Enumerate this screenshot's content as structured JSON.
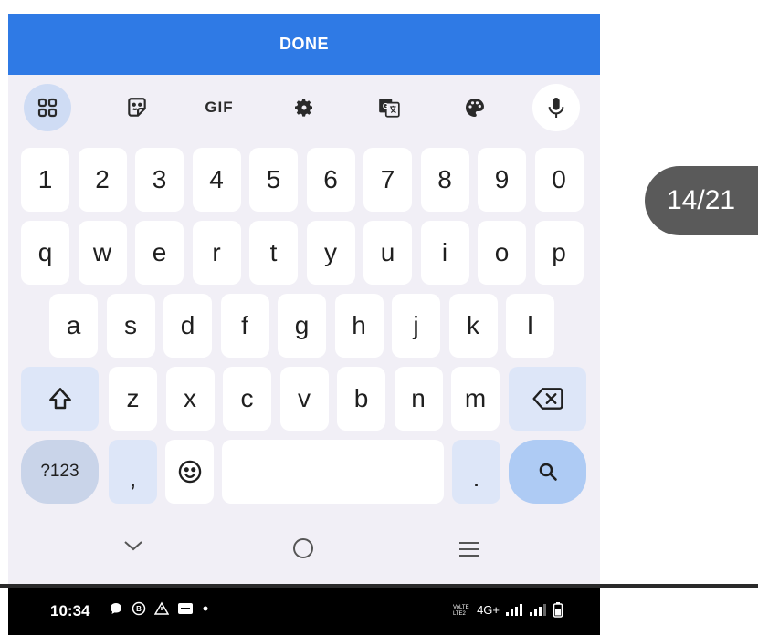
{
  "done_bar": {
    "label": "DONE"
  },
  "toolbar": {
    "gif_label": "GIF",
    "icons": [
      "apps-grid-icon",
      "sticker-icon",
      "gif-icon",
      "settings-gear-icon",
      "translate-icon",
      "palette-icon",
      "microphone-icon"
    ]
  },
  "rows": {
    "numbers": [
      "1",
      "2",
      "3",
      "4",
      "5",
      "6",
      "7",
      "8",
      "9",
      "0"
    ],
    "top": [
      "q",
      "w",
      "e",
      "r",
      "t",
      "y",
      "u",
      "i",
      "o",
      "p"
    ],
    "middle": [
      "a",
      "s",
      "d",
      "f",
      "g",
      "h",
      "j",
      "k",
      "l"
    ],
    "bottom": [
      "z",
      "x",
      "c",
      "v",
      "b",
      "n",
      "m"
    ]
  },
  "bottom_row": {
    "symbols": "?123",
    "comma": ",",
    "period": "."
  },
  "counter": "14/21",
  "status_bar": {
    "time": "10:34",
    "network": "4G+"
  },
  "colors": {
    "accent": "#2f7ae5",
    "keyboard_bg": "#f1eff6",
    "search_key": "#aecbf4"
  }
}
